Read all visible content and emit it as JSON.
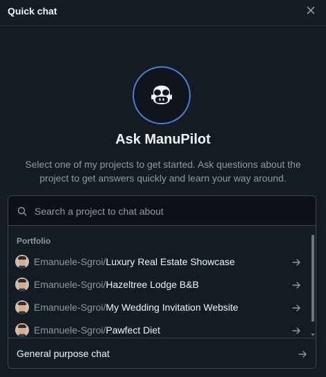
{
  "header": {
    "title": "Quick chat",
    "close_icon": "close-icon"
  },
  "hero": {
    "logo_icon": "copilot-icon",
    "title": "Ask ManuPilot",
    "subtitle": "Select one of my projects to get started. Ask questions about the project to get answers quickly and learn your way around."
  },
  "search": {
    "placeholder": "Search a project to chat about",
    "value": ""
  },
  "section_label": "Portfolio",
  "projects": [
    {
      "owner": "Emanuele-Sgroi/",
      "repo": "Luxury Real Estate Showcase"
    },
    {
      "owner": "Emanuele-Sgroi/",
      "repo": "Hazeltree Lodge B&B"
    },
    {
      "owner": "Emanuele-Sgroi/",
      "repo": "My Wedding Invitation Website"
    },
    {
      "owner": "Emanuele-Sgroi/",
      "repo": "Pawfect Diet"
    }
  ],
  "footer": {
    "label": "General purpose chat"
  },
  "colors": {
    "background": "#151b23",
    "accent_ring": "#4a7fd6",
    "text_primary": "#f0f6fc",
    "text_muted": "#9198a1"
  }
}
